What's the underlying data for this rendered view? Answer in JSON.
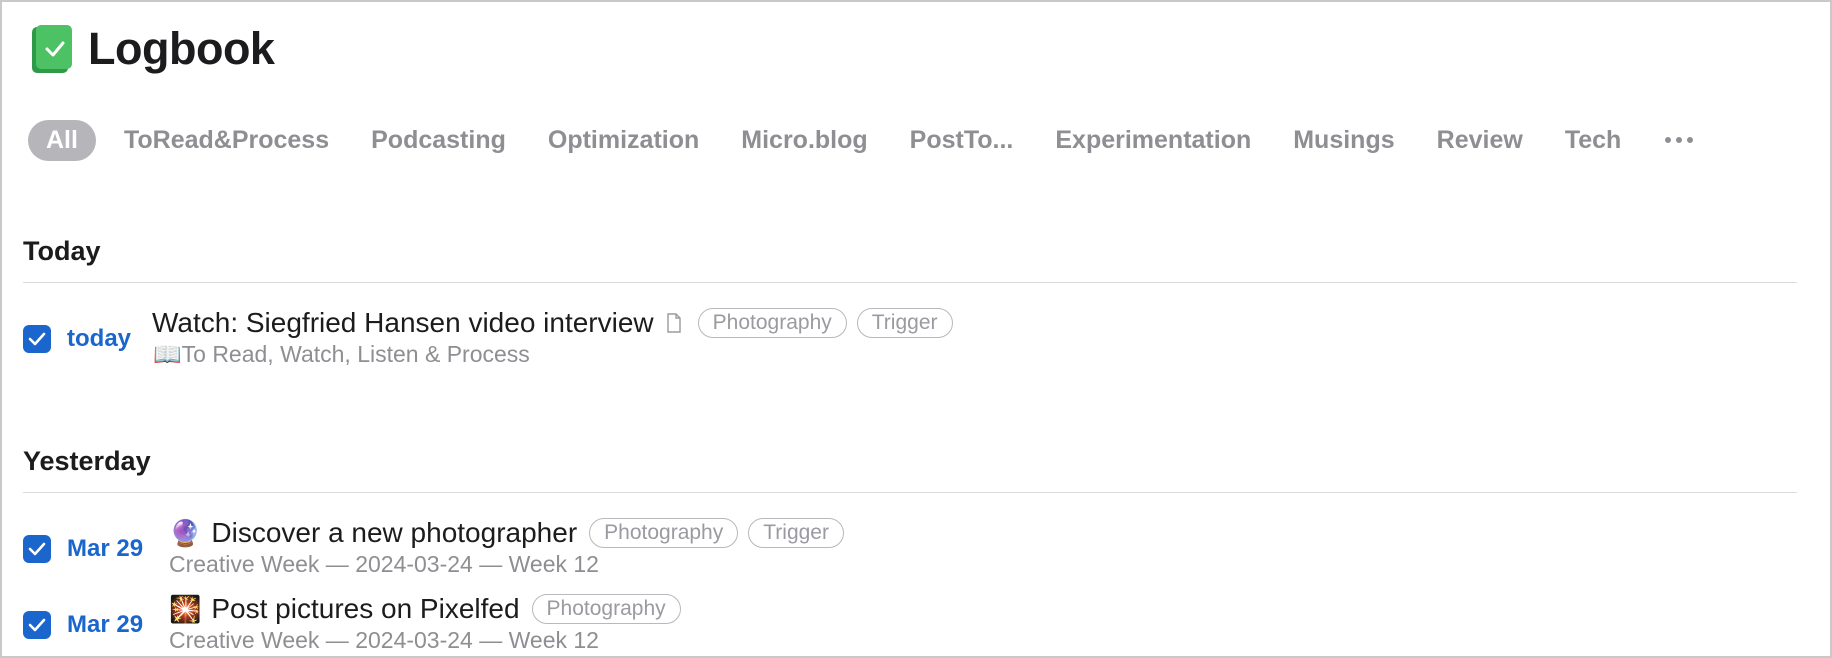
{
  "app": {
    "title": "Logbook",
    "icon": "logbook-icon",
    "accent_color": "#1a66cc",
    "icon_color": "#4cc264"
  },
  "tabs": [
    {
      "label": "All",
      "active": true
    },
    {
      "label": "ToRead&Process"
    },
    {
      "label": "Podcasting"
    },
    {
      "label": "Optimization"
    },
    {
      "label": "Micro.blog"
    },
    {
      "label": "PostTo..."
    },
    {
      "label": "Experimentation"
    },
    {
      "label": "Musings"
    },
    {
      "label": "Review"
    },
    {
      "label": "Tech"
    }
  ],
  "tabs_more_icon": "more-icon",
  "sections": [
    {
      "title": "Today",
      "items": [
        {
          "completed": true,
          "date": "today",
          "title": "Watch: Siegfried Hansen video interview",
          "has_notes": true,
          "tags": [
            "Photography",
            "Trigger"
          ],
          "subtitle": "📖To Read, Watch, Listen & Process"
        }
      ]
    },
    {
      "title": "Yesterday",
      "items": [
        {
          "completed": true,
          "date": "Mar 29",
          "emoji": "🔮",
          "title": "Discover a new photographer",
          "tags": [
            "Photography",
            "Trigger"
          ],
          "subtitle": "Creative Week — 2024-03-24 — Week 12"
        },
        {
          "completed": true,
          "date": "Mar 29",
          "emoji": "🎇",
          "title": "Post pictures on Pixelfed",
          "tags": [
            "Photography"
          ],
          "subtitle": "Creative Week — 2024-03-24 — Week 12"
        }
      ]
    }
  ]
}
